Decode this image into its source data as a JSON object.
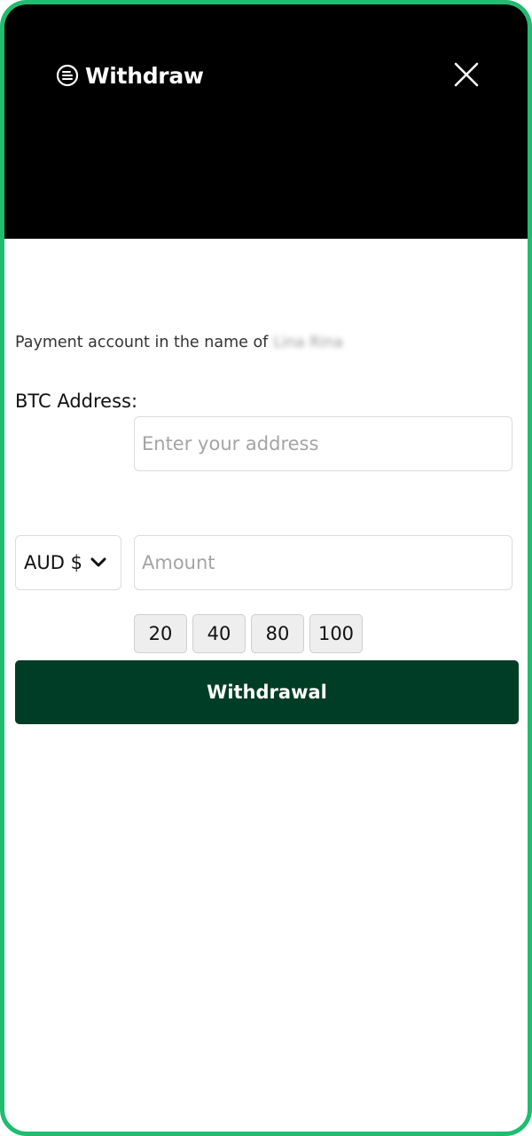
{
  "header": {
    "title": "Withdraw"
  },
  "payment": {
    "label": "Payment account in the name of",
    "holder_name": "Lina Rina"
  },
  "btc": {
    "label": "BTC Address:",
    "placeholder": "Enter your address",
    "value": ""
  },
  "currency": {
    "selected": "AUD $"
  },
  "amount": {
    "placeholder": "Amount",
    "value": ""
  },
  "presets": [
    "20",
    "40",
    "80",
    "100"
  ],
  "submit": {
    "label": "Withdrawal"
  },
  "colors": {
    "frame_border": "#1fbd6f",
    "header_bg": "#000000",
    "primary_button": "#003d26"
  }
}
